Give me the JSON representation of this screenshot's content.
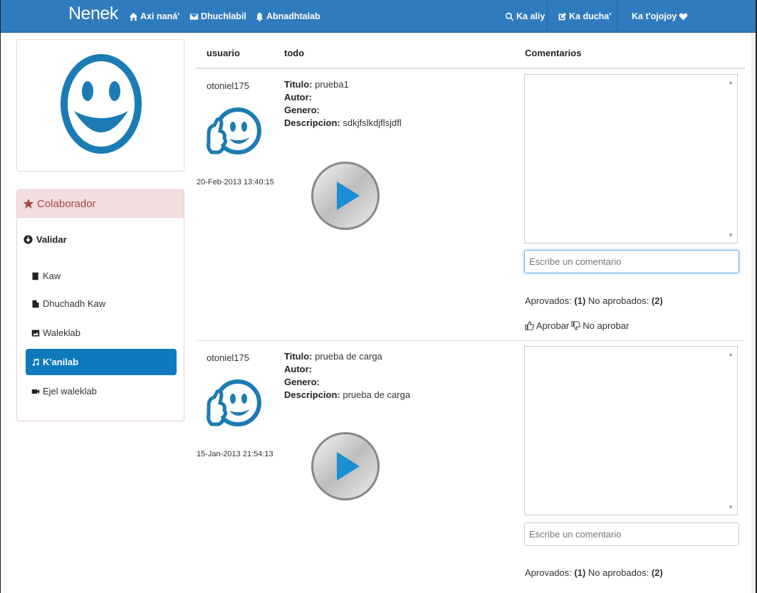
{
  "navbar": {
    "brand": "Nenek",
    "items": [
      {
        "label": "Axi naná'",
        "icon": "home-icon"
      },
      {
        "label": "Dhuchlabil",
        "icon": "envelope-icon"
      },
      {
        "label": "Abnadhtalab",
        "icon": "bell-icon"
      }
    ],
    "right": [
      {
        "label": "Ka aliy",
        "icon": "search-icon"
      },
      {
        "label": "Ka ducha'",
        "icon": "edit-icon"
      },
      {
        "label": "Ka t'ojojoy",
        "icon": "heart-icon"
      }
    ],
    "color": "#2f7bbd"
  },
  "sidebar": {
    "panel_title": "Colaborador",
    "menu_title": "Validar",
    "items": [
      {
        "label": "Kaw",
        "icon": "book-icon",
        "active": false
      },
      {
        "label": "Dhuchadh Kaw",
        "icon": "file-icon",
        "active": false
      },
      {
        "label": "Waleklab",
        "icon": "picture-icon",
        "active": false
      },
      {
        "label": "K'anilab",
        "icon": "music-icon",
        "active": true
      },
      {
        "label": "Ejel waleklab",
        "icon": "video-icon",
        "active": false
      }
    ]
  },
  "table": {
    "headers": [
      "usuario",
      "todo",
      "Comentarios"
    ],
    "rows": [
      {
        "user": "otoniel175",
        "date": "20-Feb-2013 13:40:15",
        "titulo_label": "Titulo:",
        "titulo": "prueba1",
        "autor_label": "Autor:",
        "autor": "",
        "genero_label": "Genero:",
        "genero": "",
        "descripcion_label": "Descripcion:",
        "descripcion": "sdkjfslkdjflsjdfl",
        "comment_placeholder": "Escribe un comentario",
        "aprovados_label": "Aprovados:",
        "aprovados": "(1)",
        "no_aprobados_label": "No aprobados:",
        "no_aprobados": "(2)",
        "aprobar": "Aprobar",
        "no_aprobar": "No aprobar"
      },
      {
        "user": "otoniel175",
        "date": "15-Jan-2013 21:54:13",
        "titulo_label": "Titulo:",
        "titulo": "prueba de carga",
        "autor_label": "Autor:",
        "autor": "",
        "genero_label": "Genero:",
        "genero": "",
        "descripcion_label": "Descripcion:",
        "descripcion": "prueba de carga",
        "comment_placeholder": "Escribe un comentario",
        "aprovados_label": "Aprovados:",
        "aprovados": "(1)",
        "no_aprobados_label": "No aprobados:",
        "no_aprobados": "(2)"
      }
    ]
  }
}
